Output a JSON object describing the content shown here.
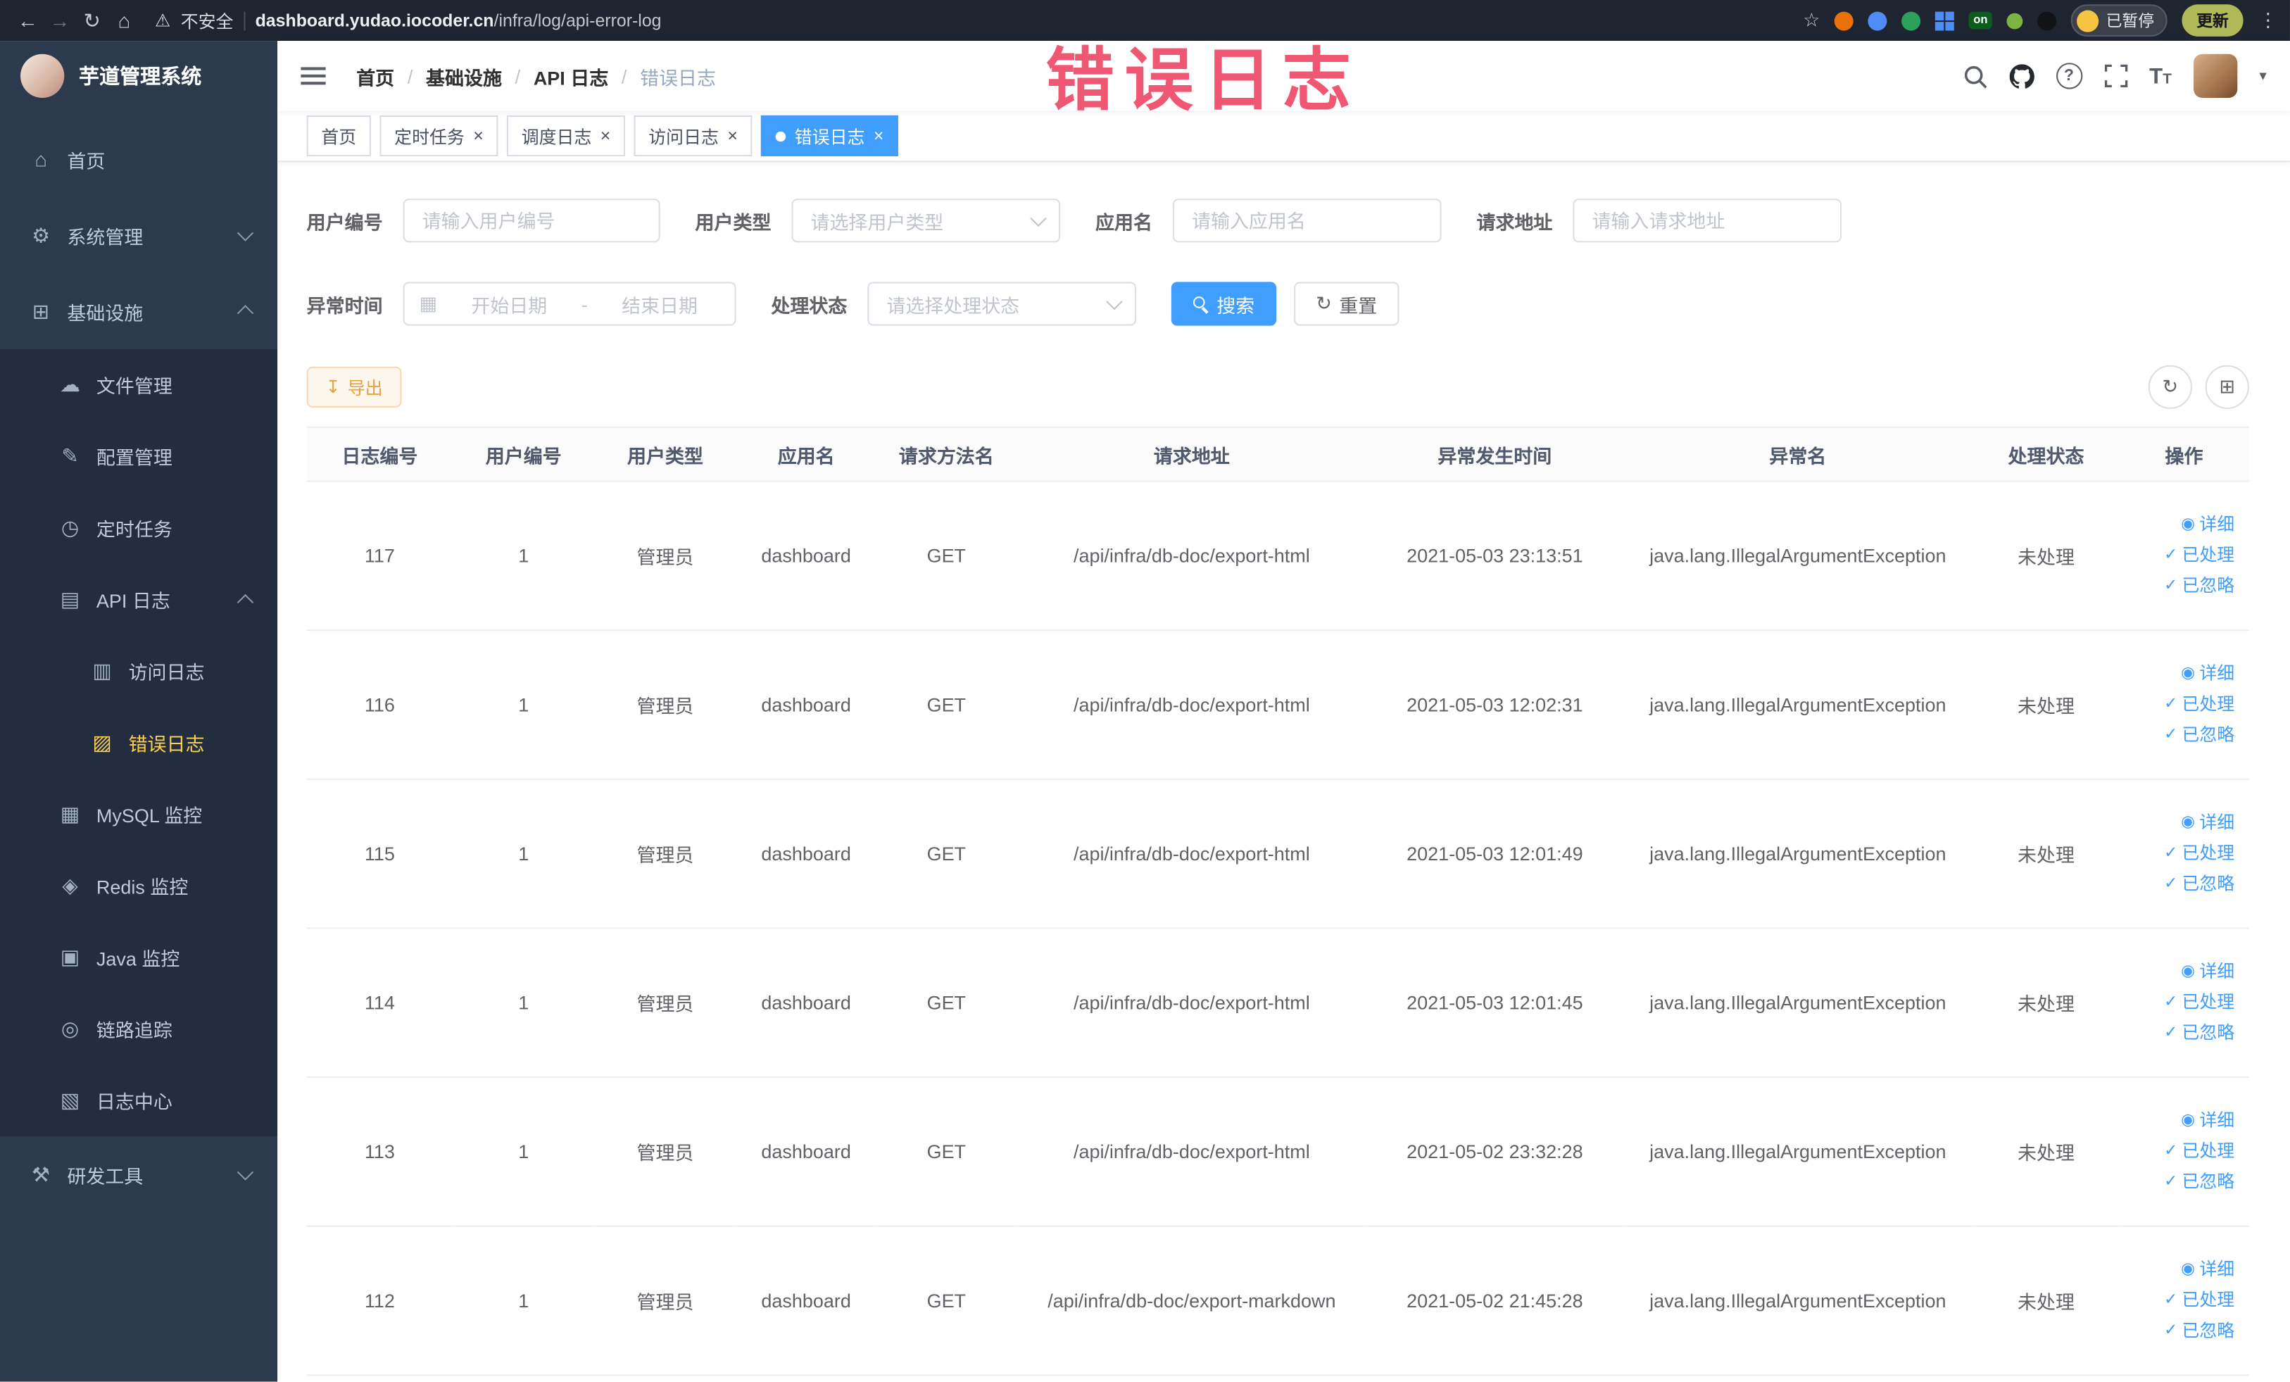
{
  "colors": {
    "accent": "#409eff",
    "sidebar_bg": "#2d3a4d",
    "sidebar_submenu_bg": "#222d40",
    "sidebar_active_text": "#ffd04b",
    "warning_text": "#e6a23c",
    "annotation": "#ef4060",
    "browser_bar_bg": "#1f2530"
  },
  "annotation": "错误日志",
  "browser": {
    "security_label": "不安全",
    "url_host": "dashboard.yudao.iocoder.cn",
    "url_path": "/infra/log/api-error-log",
    "on_badge": "on",
    "paused_label": "已暂停",
    "update_label": "更新"
  },
  "icons": {
    "back": "←",
    "forward": "→",
    "reload": "↻",
    "home": "⌂",
    "warning": "⚠",
    "star": "☆",
    "kebab": "⋮",
    "close": "×",
    "caret_down": "▾",
    "question": "?",
    "letter_t_large": "T",
    "letter_t_small": "T",
    "calendar": "▦",
    "download": "↧",
    "refresh": "↻",
    "columns": "⊞",
    "eye": "◉",
    "check": "✓",
    "menu_home": "⌂",
    "menu_system": "⚙",
    "menu_infra": "⊞",
    "menu_file": "☁",
    "menu_config": "✎",
    "menu_job": "◷",
    "menu_api_log": "▤",
    "menu_access_log": "▥",
    "menu_error_log": "▨",
    "menu_mysql": "▦",
    "menu_redis": "◈",
    "menu_java": "▣",
    "menu_trace": "◎",
    "menu_log_center": "▧",
    "menu_dev": "⚒"
  },
  "sidebar": {
    "logo_title": "芋道管理系统",
    "menu": [
      {
        "label": "首页"
      },
      {
        "label": "系统管理"
      },
      {
        "label": "基础设施"
      },
      {
        "label": "文件管理"
      },
      {
        "label": "配置管理"
      },
      {
        "label": "定时任务"
      },
      {
        "label": "API 日志"
      },
      {
        "label": "访问日志"
      },
      {
        "label": "错误日志"
      },
      {
        "label": "MySQL 监控"
      },
      {
        "label": "Redis 监控"
      },
      {
        "label": "Java 监控"
      },
      {
        "label": "链路追踪"
      },
      {
        "label": "日志中心"
      },
      {
        "label": "研发工具"
      }
    ]
  },
  "header": {
    "breadcrumb": [
      "首页",
      "基础设施",
      "API 日志",
      "错误日志"
    ],
    "separator": "/"
  },
  "tabs": [
    {
      "label": "首页"
    },
    {
      "label": "定时任务"
    },
    {
      "label": "调度日志"
    },
    {
      "label": "访问日志"
    },
    {
      "label": "错误日志"
    }
  ],
  "filters": {
    "user_id": {
      "label": "用户编号",
      "placeholder": "请输入用户编号"
    },
    "user_type": {
      "label": "用户类型",
      "placeholder": "请选择用户类型"
    },
    "app_name": {
      "label": "应用名",
      "placeholder": "请输入应用名"
    },
    "request_url": {
      "label": "请求地址",
      "placeholder": "请输入请求地址"
    },
    "time": {
      "label": "异常时间",
      "start_placeholder": "开始日期",
      "separator": "-",
      "end_placeholder": "结束日期"
    },
    "status": {
      "label": "处理状态",
      "placeholder": "请选择处理状态"
    },
    "search_label": "搜索",
    "reset_label": "重置"
  },
  "toolbar": {
    "export_label": "导出"
  },
  "table": {
    "columns": [
      "日志编号",
      "用户编号",
      "用户类型",
      "应用名",
      "请求方法名",
      "请求地址",
      "异常发生时间",
      "异常名",
      "处理状态",
      "操作"
    ],
    "action_labels": {
      "detail": "详细",
      "processed": "已处理",
      "ignored": "已忽略"
    },
    "rows": [
      {
        "id": "117",
        "user_id": "1",
        "user_type": "管理员",
        "app": "dashboard",
        "method": "GET",
        "url": "/api/infra/db-doc/export-html",
        "time": "2021-05-03 23:13:51",
        "exception": "java.lang.IllegalArgumentException",
        "status": "未处理"
      },
      {
        "id": "116",
        "user_id": "1",
        "user_type": "管理员",
        "app": "dashboard",
        "method": "GET",
        "url": "/api/infra/db-doc/export-html",
        "time": "2021-05-03 12:02:31",
        "exception": "java.lang.IllegalArgumentException",
        "status": "未处理"
      },
      {
        "id": "115",
        "user_id": "1",
        "user_type": "管理员",
        "app": "dashboard",
        "method": "GET",
        "url": "/api/infra/db-doc/export-html",
        "time": "2021-05-03 12:01:49",
        "exception": "java.lang.IllegalArgumentException",
        "status": "未处理"
      },
      {
        "id": "114",
        "user_id": "1",
        "user_type": "管理员",
        "app": "dashboard",
        "method": "GET",
        "url": "/api/infra/db-doc/export-html",
        "time": "2021-05-03 12:01:45",
        "exception": "java.lang.IllegalArgumentException",
        "status": "未处理"
      },
      {
        "id": "113",
        "user_id": "1",
        "user_type": "管理员",
        "app": "dashboard",
        "method": "GET",
        "url": "/api/infra/db-doc/export-html",
        "time": "2021-05-02 23:32:28",
        "exception": "java.lang.IllegalArgumentException",
        "status": "未处理"
      },
      {
        "id": "112",
        "user_id": "1",
        "user_type": "管理员",
        "app": "dashboard",
        "method": "GET",
        "url": "/api/infra/db-doc/export-markdown",
        "time": "2021-05-02 21:45:28",
        "exception": "java.lang.IllegalArgumentException",
        "status": "未处理"
      }
    ]
  }
}
